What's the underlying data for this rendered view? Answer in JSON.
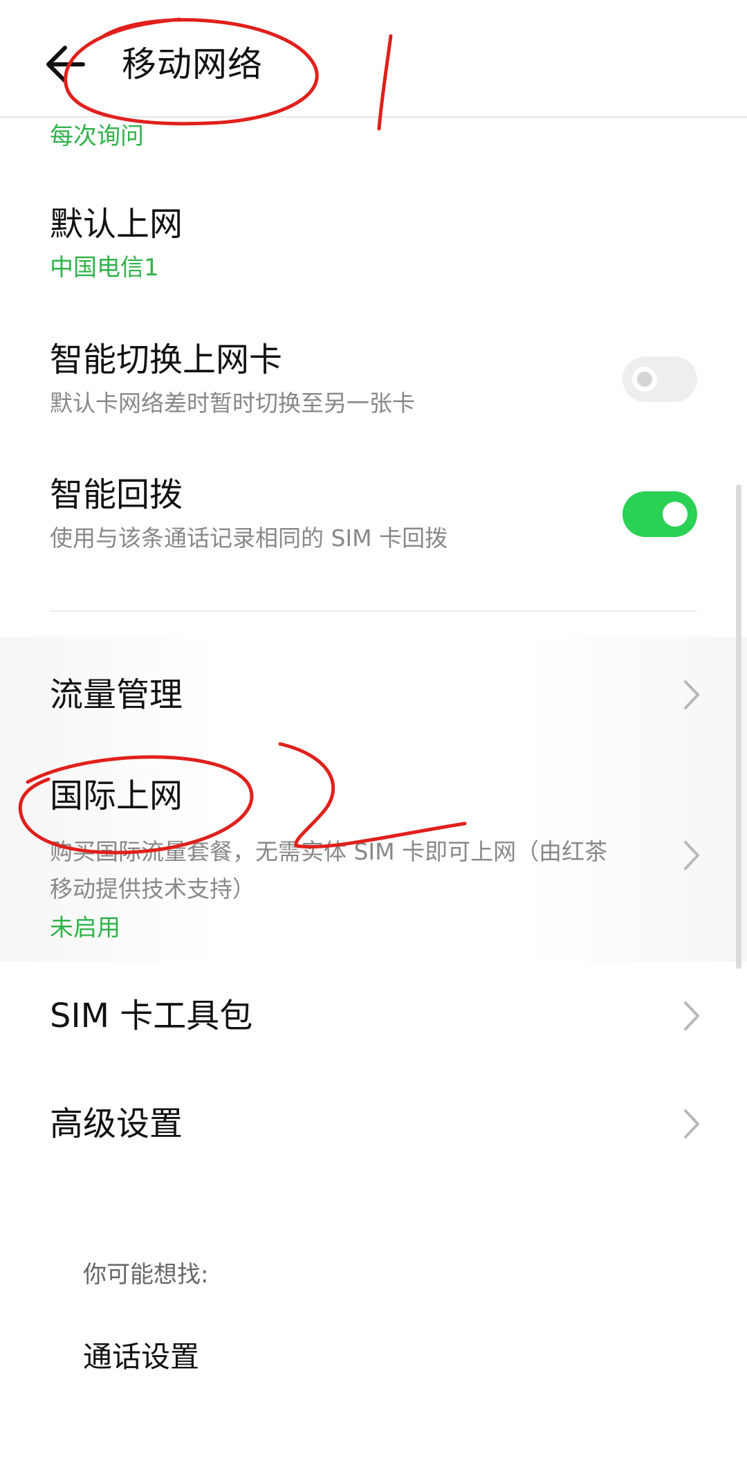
{
  "header": {
    "title": "移动网络"
  },
  "rows": {
    "ask_each_time": {
      "value": "每次询问"
    },
    "default_data": {
      "title": "默认上网",
      "value": "中国电信1"
    },
    "smart_switch": {
      "title": "智能切换上网卡",
      "subtitle": "默认卡网络差时暂时切换至另一张卡",
      "enabled": false
    },
    "smart_redial": {
      "title": "智能回拨",
      "subtitle": "使用与该条通话记录相同的 SIM 卡回拨",
      "enabled": true
    },
    "data_usage": {
      "title": "流量管理"
    },
    "intl_roaming": {
      "title": "国际上网",
      "subtitle_line1": "购买国际流量套餐，无需实体 SIM 卡即可上网（由红茶",
      "subtitle_line2": "移动提供技术支持）",
      "status": "未启用"
    },
    "sim_toolkit": {
      "title": "SIM 卡工具包"
    },
    "advanced": {
      "title": "高级设置"
    }
  },
  "suggestions": {
    "title": "你可能想找:",
    "items": [
      "通话设置"
    ]
  },
  "icons": {
    "back": "arrow-left-icon",
    "chevron": "chevron-right-icon"
  },
  "colors": {
    "accent_green": "#2fb24a",
    "toggle_on": "#2ad154",
    "annotation_red": "#e0201c"
  }
}
